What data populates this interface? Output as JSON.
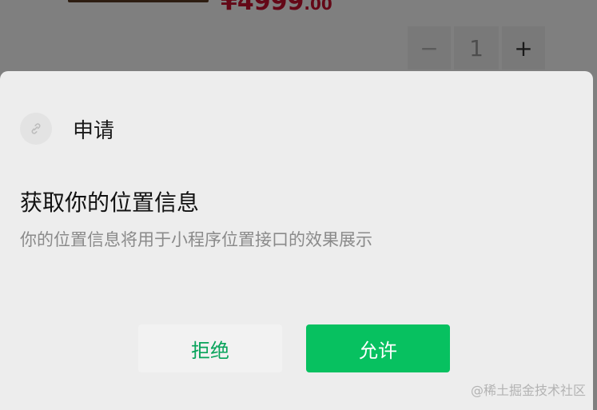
{
  "background": {
    "price": {
      "currency": "¥",
      "main": "4999",
      "cents": ".00"
    },
    "stepper": {
      "minus_label": "−",
      "value": "1",
      "plus_label": "+"
    }
  },
  "dialog": {
    "app_name": "申请",
    "app_icon": "miniprogram-link-icon",
    "title": "获取你的位置信息",
    "description": "你的位置信息将用于小程序位置接口的效果展示",
    "reject_label": "拒绝",
    "allow_label": "允许"
  },
  "watermark": "@稀土掘金技术社区",
  "colors": {
    "accent_green": "#07c160",
    "reject_text": "#07a35a",
    "price_red": "#c8102e",
    "sheet_bg": "#ededed"
  }
}
